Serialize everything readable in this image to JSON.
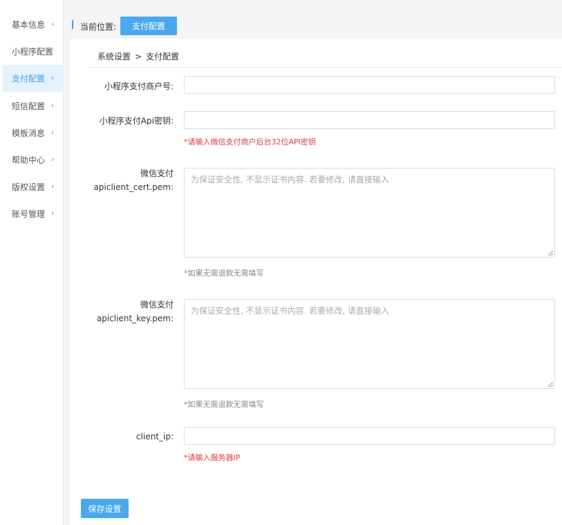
{
  "sidebar": {
    "items": [
      {
        "label": "基本信息",
        "has_chevron": true,
        "active": false
      },
      {
        "label": "小程序配置",
        "has_chevron": false,
        "active": false
      },
      {
        "label": "支付配置",
        "has_chevron": true,
        "active": true
      },
      {
        "label": "短信配置",
        "has_chevron": true,
        "active": false
      },
      {
        "label": "模板消息",
        "has_chevron": true,
        "active": false
      },
      {
        "label": "帮助中心",
        "has_chevron": true,
        "active": false
      },
      {
        "label": "版权设置",
        "has_chevron": true,
        "active": false
      },
      {
        "label": "账号管理",
        "has_chevron": true,
        "active": false
      }
    ],
    "chevron_icon": "chevron-right-icon"
  },
  "header": {
    "location_label": "当前位置:",
    "location_button": "支付配置"
  },
  "breadcrumb": {
    "parent": "系统设置",
    "separator": ">",
    "current": "支付配置"
  },
  "form": {
    "merchant_id": {
      "label": "小程序支付商户号:",
      "value": ""
    },
    "api_key": {
      "label": "小程序支付Api密钥:",
      "value": "",
      "hint": "*请输入微信支付商户后台32位API密钥"
    },
    "cert_pem": {
      "label_line1": "微信支付",
      "label_line2": "apiclient_cert.pem:",
      "placeholder": "为保证安全性, 不显示证书内容. 若要修改, 请直接输入",
      "hint": "*如果无需退款无需填写"
    },
    "key_pem": {
      "label_line1": "微信支付",
      "label_line2": "apiclient_key.pem:",
      "placeholder": "为保证安全性, 不显示证书内容. 若要修改, 请直接输入",
      "hint": "*如果无需退款无需填写"
    },
    "client_ip": {
      "label": "client_ip:",
      "value": "",
      "hint": "*请输入服务器IP"
    }
  },
  "save_button": "保存设置",
  "colors": {
    "accent": "#4aa9ee",
    "error": "#e23a3a",
    "active_bg": "#e6f2fb"
  }
}
